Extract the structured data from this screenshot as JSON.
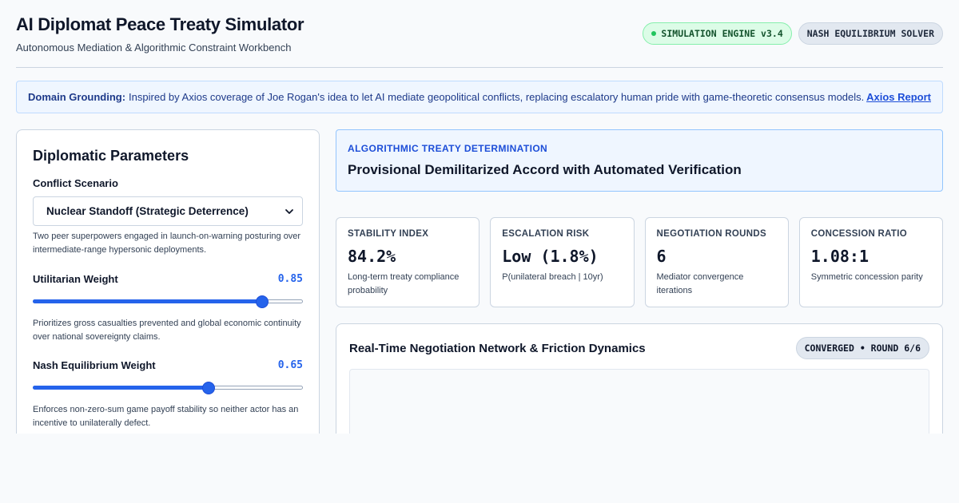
{
  "header": {
    "title": "AI Diplomat Peace Treaty Simulator",
    "subtitle": "Autonomous Mediation & Algorithmic Constraint Workbench",
    "badges": [
      "SIMULATION ENGINE v3.4",
      "NASH EQUILIBRIUM SOLVER"
    ]
  },
  "grounding": {
    "label": "Domain Grounding:",
    "text": "Inspired by Axios coverage of Joe Rogan's idea to let AI mediate geopolitical conflicts, replacing escalatory human pride with game-theoretic consensus models.",
    "link": "Axios Report"
  },
  "params": {
    "title": "Diplomatic Parameters",
    "scenario": {
      "label": "Conflict Scenario",
      "selected": "Nuclear Standoff (Strategic Deterrence)",
      "help": "Two peer superpowers engaged in launch-on-warning posturing over intermediate-range hypersonic deployments."
    },
    "utilitarian": {
      "label": "Utilitarian Weight",
      "value": "0.85",
      "fraction": 0.85,
      "help": "Prioritizes gross casualties prevented and global economic continuity over national sovereignty claims."
    },
    "nash": {
      "label": "Nash Equilibrium Weight",
      "value": "0.65",
      "fraction": 0.65,
      "help": "Enforces non-zero-sum game payoff stability so neither actor has an incentive to unilaterally defect."
    }
  },
  "determination": {
    "label": "ALGORITHMIC TREATY DETERMINATION",
    "value": "Provisional Demilitarized Accord with Automated Verification"
  },
  "metrics": [
    {
      "label": "STABILITY INDEX",
      "value": "84.2%",
      "desc": "Long-term treaty compliance probability"
    },
    {
      "label": "ESCALATION RISK",
      "value": "Low (1.8%)",
      "desc": "P(unilateral breach | 10yr)"
    },
    {
      "label": "NEGOTIATION ROUNDS",
      "value": "6",
      "desc": "Mediator convergence iterations"
    },
    {
      "label": "CONCESSION RATIO",
      "value": "1.08:1",
      "desc": "Symmetric concession parity"
    }
  ],
  "network": {
    "title": "Real-Time Negotiation Network & Friction Dynamics",
    "badge": "CONVERGED • ROUND 6/6"
  },
  "colors": {
    "accent": "#2563eb",
    "success": "#22c55e",
    "background": "#f8fafc"
  }
}
